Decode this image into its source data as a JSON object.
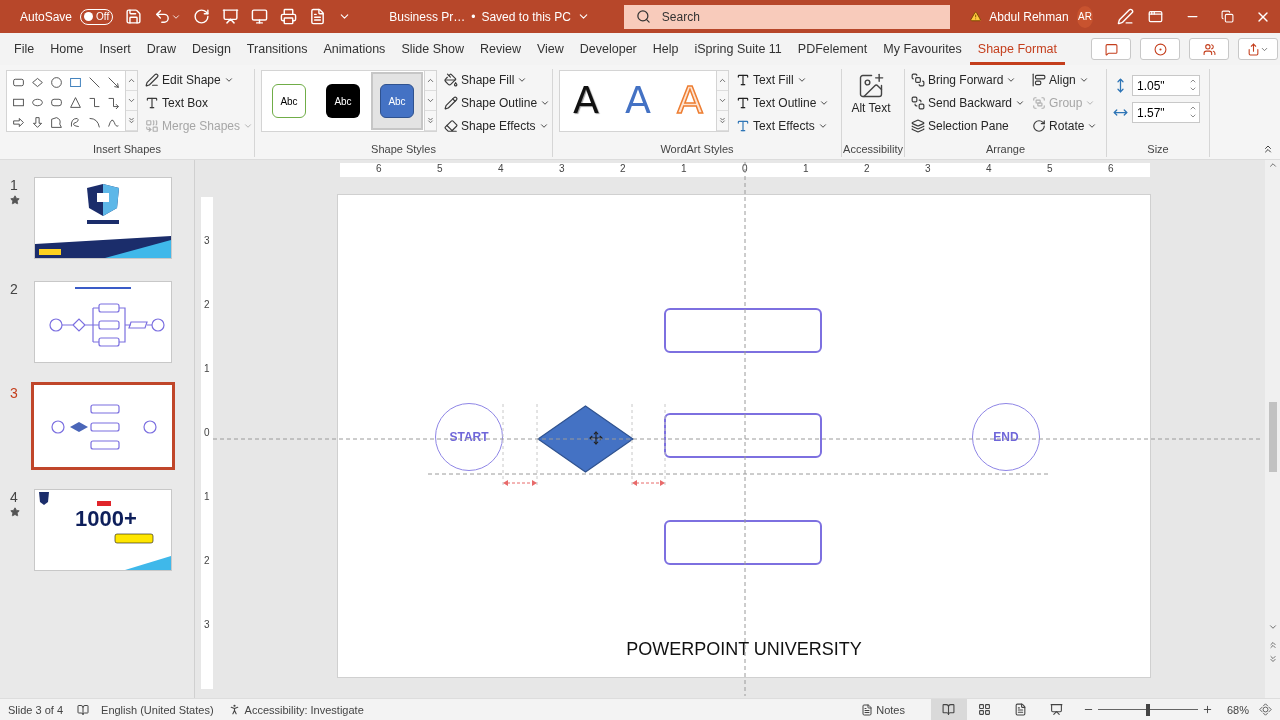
{
  "title_bar": {
    "autosave_label": "AutoSave",
    "autosave_state": "Off",
    "document": "Business Pr…",
    "separator": "•",
    "save_status": "Saved to this PC",
    "search_placeholder": "Search",
    "user": "Abdul Rehman",
    "initials": "AR"
  },
  "menu_tabs": [
    {
      "label": "File",
      "selected": false
    },
    {
      "label": "Home",
      "selected": false
    },
    {
      "label": "Insert",
      "selected": false
    },
    {
      "label": "Draw",
      "selected": false
    },
    {
      "label": "Design",
      "selected": false
    },
    {
      "label": "Transitions",
      "selected": false
    },
    {
      "label": "Animations",
      "selected": false
    },
    {
      "label": "Slide Show",
      "selected": false
    },
    {
      "label": "Review",
      "selected": false
    },
    {
      "label": "View",
      "selected": false
    },
    {
      "label": "Developer",
      "selected": false
    },
    {
      "label": "Help",
      "selected": false
    },
    {
      "label": "iSpring Suite 11",
      "selected": false
    },
    {
      "label": "PDFelement",
      "selected": false
    },
    {
      "label": "My Favourites",
      "selected": false
    },
    {
      "label": "Shape Format",
      "selected": true
    }
  ],
  "ribbon": {
    "insert_shapes": {
      "title": "Insert Shapes",
      "commands": [
        {
          "label": "Edit Shape",
          "has_menu": true,
          "disabled": false
        },
        {
          "label": "Text Box",
          "has_menu": false,
          "disabled": false
        },
        {
          "label": "Merge Shapes",
          "has_menu": true,
          "disabled": true
        }
      ]
    },
    "shape_styles": {
      "title": "Shape Styles",
      "presets": [
        {
          "label": "Abc",
          "kind": "outline",
          "selected": false
        },
        {
          "label": "Abc",
          "kind": "dark",
          "selected": false
        },
        {
          "label": "Abc",
          "kind": "blue",
          "selected": true
        }
      ],
      "commands": [
        {
          "label": "Shape Fill",
          "has_menu": true,
          "disabled": false
        },
        {
          "label": "Shape Outline",
          "has_menu": true,
          "disabled": false
        },
        {
          "label": "Shape Effects",
          "has_menu": true,
          "disabled": false
        }
      ]
    },
    "wordart_styles": {
      "title": "WordArt Styles",
      "presets": [
        {
          "label": "A",
          "kind": "black"
        },
        {
          "label": "A",
          "kind": "blue"
        },
        {
          "label": "A",
          "kind": "orange"
        }
      ],
      "commands": [
        {
          "label": "Text Fill",
          "has_menu": true,
          "disabled": false
        },
        {
          "label": "Text Outline",
          "has_menu": true,
          "disabled": false
        },
        {
          "label": "Text Effects",
          "has_menu": true,
          "disabled": false
        }
      ]
    },
    "accessibility": {
      "title": "Accessibility",
      "command": "Alt Text"
    },
    "arrange": {
      "title": "Arrange",
      "commands": [
        {
          "label": "Bring Forward",
          "has_menu": true,
          "disabled": false
        },
        {
          "label": "Send Backward",
          "has_menu": true,
          "disabled": false
        },
        {
          "label": "Selection Pane",
          "has_menu": false,
          "disabled": false
        },
        {
          "label": "Align",
          "has_menu": true,
          "disabled": false
        },
        {
          "label": "Group",
          "has_menu": true,
          "disabled": true
        },
        {
          "label": "Rotate",
          "has_menu": true,
          "disabled": false
        }
      ]
    },
    "size": {
      "title": "Size",
      "height": "1.05\"",
      "width": "1.57\""
    }
  },
  "slides": [
    {
      "number": "1",
      "starred": true,
      "selected": false,
      "kind": "title"
    },
    {
      "number": "2",
      "starred": false,
      "selected": false,
      "kind": "flowchart"
    },
    {
      "number": "3",
      "starred": false,
      "selected": true,
      "kind": "layout"
    },
    {
      "number": "4",
      "starred": true,
      "selected": false,
      "kind": "promo",
      "headline": "1000+"
    }
  ],
  "rulers": {
    "horizontal": [
      "6",
      "5",
      "4",
      "3",
      "2",
      "1",
      "0",
      "1",
      "2",
      "3",
      "4",
      "5",
      "6"
    ],
    "vertical": [
      "3",
      "2",
      "1",
      "0",
      "1",
      "2",
      "3"
    ]
  },
  "slide": {
    "shapes": [
      {
        "kind": "circle",
        "label": "START",
        "selected": false
      },
      {
        "kind": "diamond",
        "selected": true
      },
      {
        "kind": "box",
        "selected": false
      },
      {
        "kind": "box",
        "selected": false
      },
      {
        "kind": "box",
        "selected": false
      },
      {
        "kind": "circle",
        "label": "END",
        "selected": false
      }
    ],
    "footer": "POWERPOINT UNIVERSITY"
  },
  "status_bar": {
    "slide_info": "Slide 3 of 4",
    "language": "English (United States)",
    "accessibility": "Accessibility: Investigate",
    "notes": "Notes",
    "views": [
      {
        "kind": "normal",
        "selected": true
      },
      {
        "kind": "sorter",
        "selected": false
      },
      {
        "kind": "reading",
        "selected": false
      },
      {
        "kind": "slideshow",
        "selected": false
      }
    ],
    "zoom_slider": {
      "level": 0.5
    },
    "zoom": "68%"
  }
}
